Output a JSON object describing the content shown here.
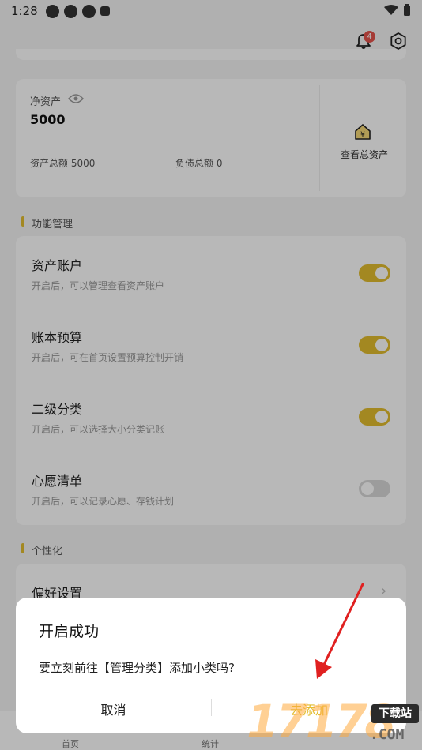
{
  "status_bar": {
    "time": "1:28"
  },
  "header": {
    "notification_count": "4"
  },
  "asset_card": {
    "net_label": "净资产",
    "net_value": "5000",
    "total_assets": "资产总额 5000",
    "total_debt": "负债总额 0",
    "view_all_label": "查看总资产"
  },
  "features": {
    "section_title": "功能管理",
    "items": [
      {
        "title": "资产账户",
        "desc": "开启后，可以管理查看资产账户",
        "enabled": true
      },
      {
        "title": "账本预算",
        "desc": "开启后，可在首页设置预算控制开销",
        "enabled": true
      },
      {
        "title": "二级分类",
        "desc": "开启后，可以选择大小分类记账",
        "enabled": true
      },
      {
        "title": "心愿清单",
        "desc": "开启后，可以记录心愿、存钱计划",
        "enabled": false
      }
    ]
  },
  "personalization": {
    "section_title": "个性化",
    "items": [
      {
        "title": "偏好设置"
      }
    ]
  },
  "tabbar": {
    "tabs": [
      "首页",
      "统计"
    ]
  },
  "dialog": {
    "title": "开启成功",
    "message": "要立刻前往【管理分类】添加小类吗?",
    "cancel_label": "取消",
    "confirm_label": "去添加"
  },
  "watermark": {
    "text": "17178",
    "tag": "下载站",
    "domain": ".COM"
  },
  "colors": {
    "accent": "#e2bd2f",
    "badge": "#e5534b",
    "arrow": "#e02020"
  }
}
